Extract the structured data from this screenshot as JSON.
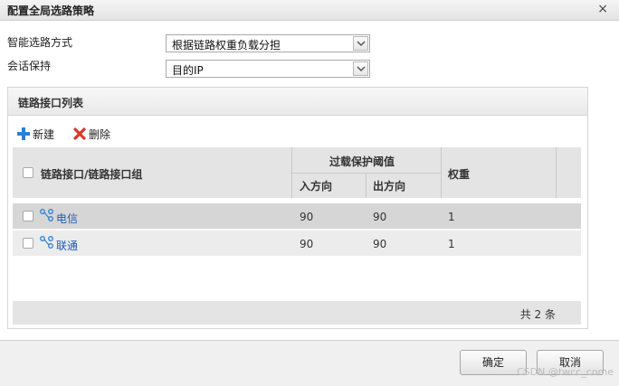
{
  "dialog": {
    "title": "配置全局选路策略",
    "close_glyph": "×"
  },
  "form": {
    "routing_mode_label": "智能选路方式",
    "routing_mode_value": "根据链路权重负载分担",
    "session_keep_label": "会话保持",
    "session_keep_value": "目的IP"
  },
  "panel": {
    "title": "链路接口列表",
    "toolbar": {
      "new_label": "新建",
      "delete_label": "删除"
    },
    "table": {
      "col_interface": "链路接口/链路接口组",
      "col_overload": "过载保护阈值",
      "col_in": "入方向",
      "col_out": "出方向",
      "col_weight": "权重",
      "rows": [
        {
          "name": "电信",
          "in": "90",
          "out": "90",
          "weight": "1"
        },
        {
          "name": "联通",
          "in": "90",
          "out": "90",
          "weight": "1"
        }
      ],
      "total": "共 2 条"
    }
  },
  "buttons": {
    "ok": "确定",
    "cancel": "取消"
  },
  "watermark": "CSDN @twcc_come",
  "colors": {
    "link": "#1a5fb4",
    "header_bg": "#e4e4e4",
    "selected_row_bg": "#d6d6d6",
    "new_icon": "#2f7fd1",
    "delete_icon": "#d43b2a"
  }
}
